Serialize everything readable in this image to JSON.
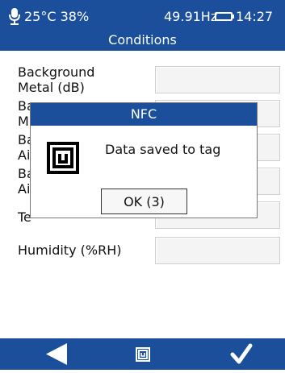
{
  "status": {
    "temperature": "25°C",
    "humidity": "38%",
    "frequency": "49.91Hz",
    "time": "14:27"
  },
  "header": {
    "title": "Conditions"
  },
  "form": {
    "rows": [
      {
        "label_line1": "Background",
        "label_line2": "Metal (dB)",
        "value": ""
      },
      {
        "label_line1": "Ba",
        "label_line2": "M",
        "value": ""
      },
      {
        "label_line1": "Ba",
        "label_line2": "Ai",
        "value": ""
      },
      {
        "label_line1": "Ba",
        "label_line2": "Ai",
        "value": ""
      },
      {
        "label_line1": "Te",
        "value": ""
      },
      {
        "label_line1": "Humidity (%RH)",
        "value": ""
      }
    ]
  },
  "dialog": {
    "title": "NFC",
    "message": "Data saved to tag",
    "ok_label": "OK (3)",
    "icon": "nfc-tag-icon"
  },
  "footer": {
    "back_icon": "back-arrow-icon",
    "nfc_icon": "nfc-tag-icon",
    "confirm_icon": "checkmark-icon"
  },
  "colors": {
    "bar": "#1b4f9b",
    "field_bg": "#f4f4f4"
  }
}
